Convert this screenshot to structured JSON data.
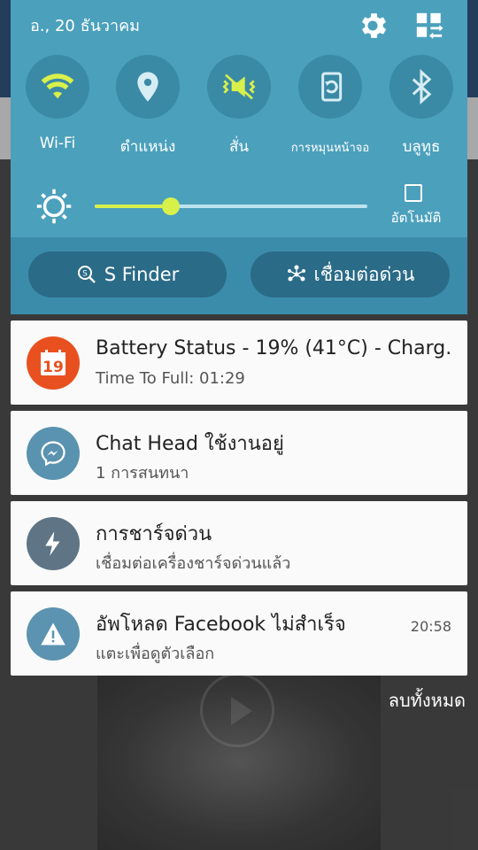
{
  "status": {
    "date": "อ., 20 ธันวาคม"
  },
  "quick_toggles": [
    {
      "label": "Wi-Fi",
      "icon": "wifi-icon",
      "active": true
    },
    {
      "label": "ตำแหน่ง",
      "icon": "location-icon",
      "active": false
    },
    {
      "label": "สั่น",
      "icon": "vibrate-icon",
      "active": true
    },
    {
      "label": "การหมุนหน้าจอ",
      "icon": "rotate-icon",
      "active": false
    },
    {
      "label": "บลูทูธ",
      "icon": "bluetooth-icon",
      "active": false
    }
  ],
  "brightness": {
    "level": 0.28,
    "auto_label": "อัตโนมัติ",
    "auto_checked": false
  },
  "buttons": {
    "s_finder": "S Finder",
    "quick_connect": "เชื่อมต่อด่วน"
  },
  "notifications": [
    {
      "title": "Battery Status - 19% (41°C) - Charg..",
      "subtitle": "Time To Full: 01:29",
      "icon_text": "19",
      "time": ""
    },
    {
      "title": "Chat Head ใช้งานอยู่",
      "subtitle": "1 การสนทนา",
      "time": ""
    },
    {
      "title": "การชาร์จด่วน",
      "subtitle": "เชื่อมต่อเครื่องชาร์จด่วนแล้ว",
      "time": ""
    },
    {
      "title": "อัพโหลด Facebook ไม่สำเร็จ",
      "subtitle": "แตะเพื่อดูตัวเลือก",
      "time": "20:58"
    }
  ],
  "clear_all": "ลบทั้งหมด",
  "colors": {
    "panel": "#4ba0bc",
    "accent": "#d8f04a",
    "battery": "#e8511f",
    "messenger": "#5a93b0",
    "charge": "#5f7585",
    "warning": "#5c93b0"
  }
}
